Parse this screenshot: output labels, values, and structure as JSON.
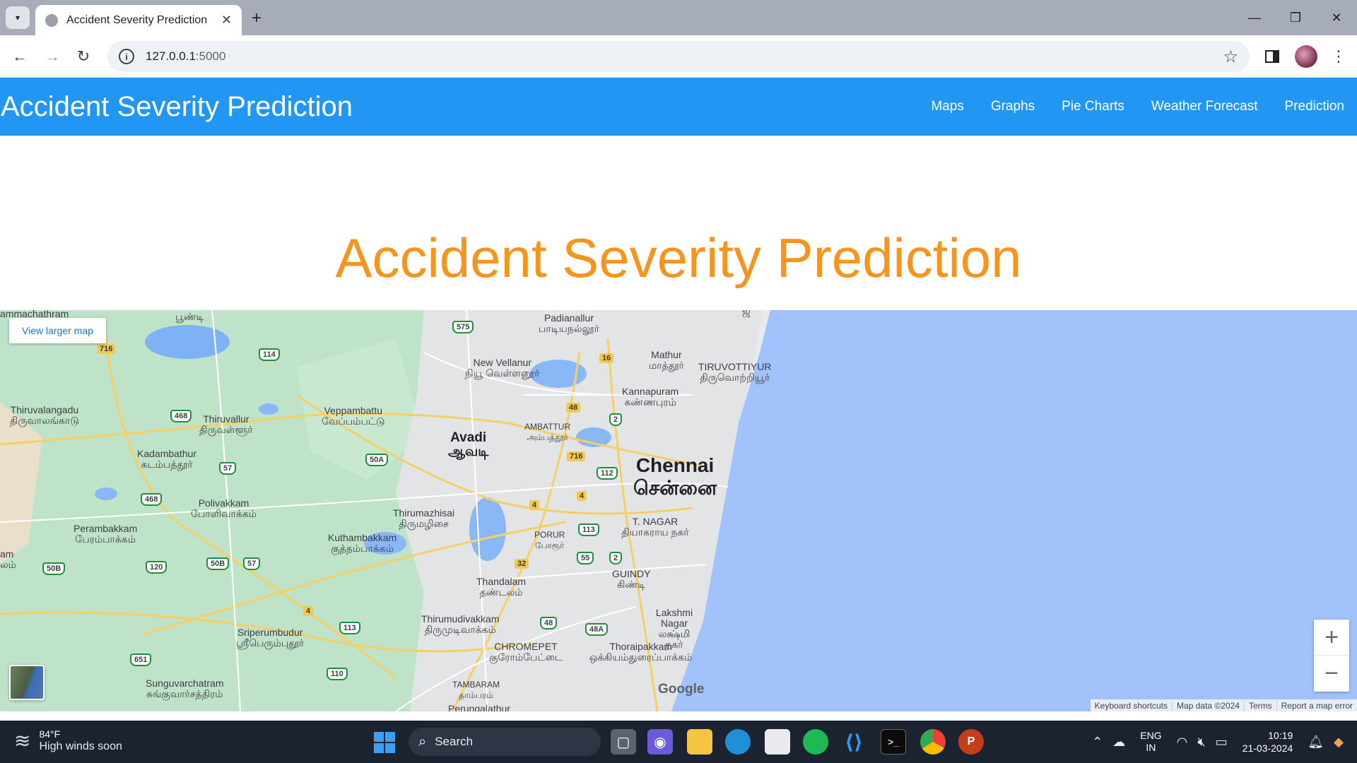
{
  "browser": {
    "tab_title": "Accident Severity Prediction",
    "url_host": "127.0.0.1",
    "url_port": ":5000"
  },
  "navbar": {
    "brand": "Accident Severity Prediction",
    "links": [
      "Maps",
      "Graphs",
      "Pie Charts",
      "Weather Forecast",
      "Prediction"
    ]
  },
  "heading": "Accident Severity Prediction",
  "map": {
    "view_larger": "View larger map",
    "places": {
      "ammachathram": "ammachathram",
      "poondi": "பூண்டி",
      "padianallur_en": "Padianallur",
      "padianallur_ta": "பாடியநல்லூர்",
      "mathur_en": "Mathur",
      "mathur_ta": "மாத்தூர்",
      "tiruvottiyur_en": "TIRUVOTTIYUR",
      "tiruvottiyur_ta": "திருவொற்றியூர்",
      "new_vellanur_en": "New Vellanur",
      "new_vellanur_ta": "நியூ வெள்ளனூர்",
      "kannapuram_en": "Kannapuram",
      "kannapuram_ta": "கண்ணபுரம்",
      "thiruvalangadu_en": "Thiruvalangadu",
      "thiruvalangadu_ta": "திருவாலங்காடு",
      "thiruvallur_en": "Thiruvallur",
      "thiruvallur_ta": "திருவள்ளூர்",
      "veppambattu_en": "Veppambattu",
      "veppambattu_ta": "வேப்பம்பட்டு",
      "avadi_en": "Avadi",
      "avadi_ta": "ஆவடி",
      "ambattur_en": "AMBATTUR",
      "ambattur_ta": "அம்பத்தூர்",
      "kadambathur_en": "Kadambathur",
      "kadambathur_ta": "கடம்பத்தூர்",
      "chennai_en": "Chennai",
      "chennai_ta": "சென்னை",
      "polivakkam_en": "Polivakkam",
      "polivakkam_ta": "போளிவாக்கம்",
      "thirumazhisai_en": "Thirumazhisai",
      "thirumazhisai_ta": "திருமழிசை",
      "perambakkam_en": "Perambakkam",
      "perambakkam_ta": "பேரம்பாக்கம்",
      "kuthambakkam_en": "Kuthambakkam",
      "kuthambakkam_ta": "குத்தம்பாக்கம்",
      "tnagar_en": "T. NAGAR",
      "tnagar_ta": "தியாகராய நகர்",
      "porur_en": "PORUR",
      "porur_ta": "போரூர்",
      "am": "am",
      "lam": "லம்",
      "guindy_en": "GUINDY",
      "guindy_ta": "கிண்டி",
      "thandalam_en": "Thandalam",
      "thandalam_ta": "தண்டலம்",
      "lakshmi_en": "Lakshmi Nagar",
      "lakshmi_ta": "லக்ஷ்மி நகர்",
      "sriperumbudur_en": "Sriperumbudur",
      "sriperumbudur_ta": "ஸ்ரீபெரும்புதூர்",
      "thirumudivakkam_en": "Thirumudivakkam",
      "thirumudivakkam_ta": "திருமுடிவாக்கம்",
      "chromepet_en": "CHROMEPET",
      "chromepet_ta": "குரோம்பேட்டை",
      "thoraipakkam_en": "Thoraipakkam",
      "thoraipakkam_ta": "ஒக்கியம்துரைப்பாக்கம்",
      "sunguvarchatram_en": "Sunguvarchatram",
      "sunguvarchatram_ta": "சுங்குவார்சத்திரம்",
      "tambaram_en": "TAMBARAM",
      "tambaram_ta": "தாம்பரம்",
      "perungalathur": "Perungalathur",
      "edge_ta": "ஜ"
    },
    "routes": {
      "r575": "575",
      "r716a": "716",
      "r114": "114",
      "r16": "16",
      "r48a": "48",
      "r468a": "468",
      "r2a": "2",
      "r50a": "50A",
      "r716b": "716",
      "r57a": "57",
      "r112": "112",
      "r468b": "468",
      "r4a": "4",
      "r4b": "4",
      "r113a": "113",
      "r50b": "50B",
      "r120": "120",
      "r50b2": "50B",
      "r57b": "57",
      "r55": "55",
      "r2b": "2",
      "r32": "32",
      "r4c": "4",
      "r113b": "113",
      "r48b": "48",
      "r48a2": "48A",
      "r651": "651",
      "r110": "110"
    },
    "google": "Google",
    "footer": [
      "Keyboard shortcuts",
      "Map data ©2024",
      "Terms",
      "Report a map error"
    ],
    "zoom_in": "+",
    "zoom_out": "−"
  },
  "taskbar": {
    "weather_temp": "84°F",
    "weather_desc": "High winds soon",
    "search": "Search",
    "lang1": "ENG",
    "lang2": "IN",
    "time": "10:19",
    "date": "21-03-2024"
  }
}
